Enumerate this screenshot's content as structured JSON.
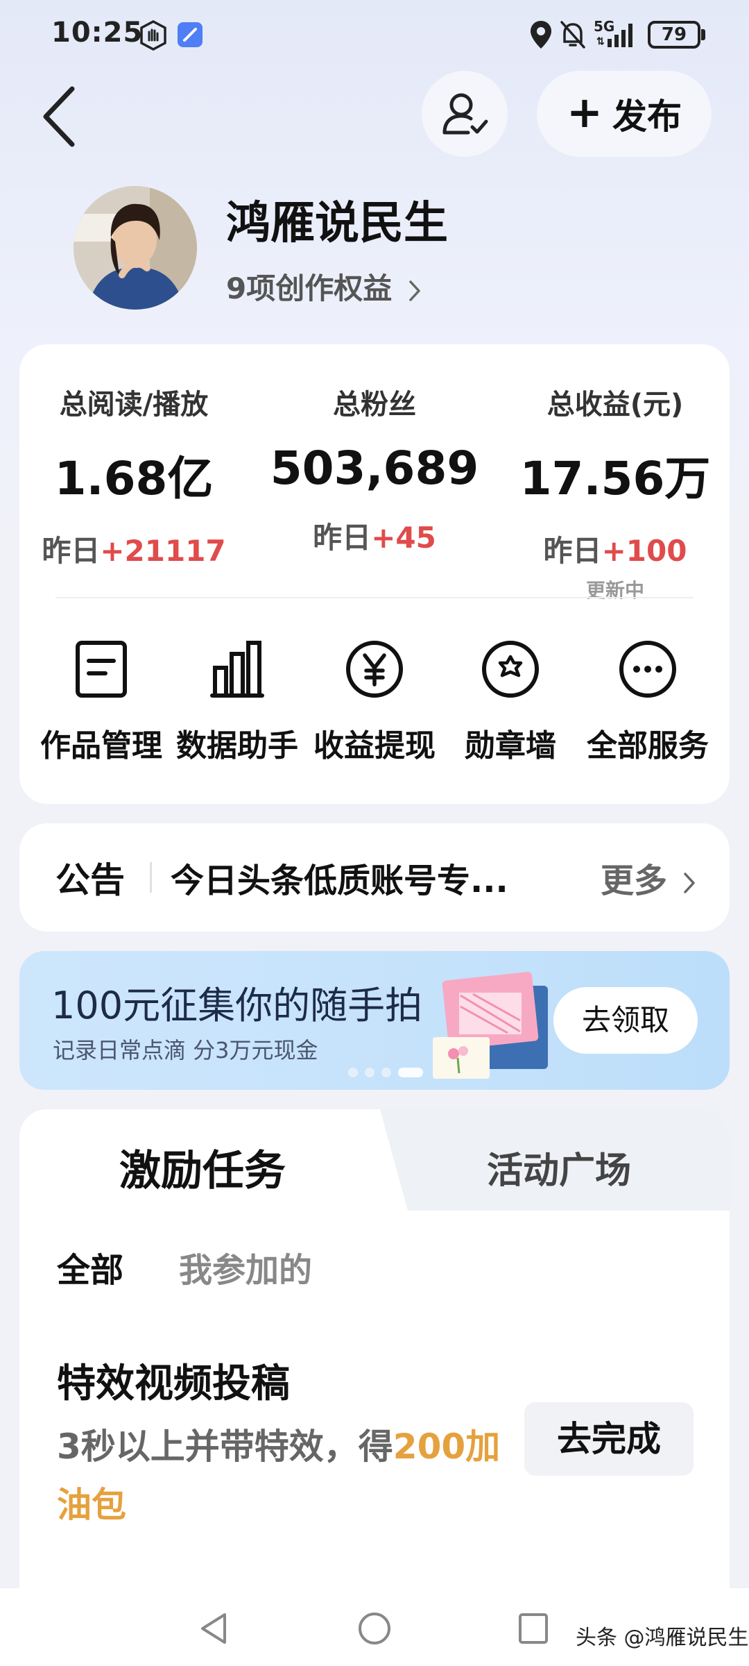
{
  "status_bar": {
    "time": "10:25",
    "network": "5G",
    "battery": "79"
  },
  "header": {
    "publish_label": "发布"
  },
  "profile": {
    "name": "鸿雁说民生",
    "rights_link": "9项创作权益"
  },
  "stats": [
    {
      "label": "总阅读/播放",
      "value": "1.68亿",
      "delta_prefix": "昨日",
      "delta": "+21117",
      "note": ""
    },
    {
      "label": "总粉丝",
      "value": "503,689",
      "delta_prefix": "昨日",
      "delta": "+45",
      "note": ""
    },
    {
      "label": "总收益(元)",
      "value": "17.56万",
      "delta_prefix": "昨日",
      "delta": "+100",
      "note": "更新中"
    }
  ],
  "services": [
    {
      "label": "作品管理",
      "icon": "document-icon"
    },
    {
      "label": "数据助手",
      "icon": "bar-chart-icon"
    },
    {
      "label": "收益提现",
      "icon": "yen-icon"
    },
    {
      "label": "勋章墙",
      "icon": "medal-icon"
    },
    {
      "label": "全部服务",
      "icon": "more-icon"
    }
  ],
  "notice": {
    "title": "公告",
    "text": "今日头条低质账号专...",
    "more": "更多"
  },
  "banner": {
    "title": "100元征集你的随手拍",
    "subtitle": "记录日常点滴 分3万元现金",
    "button": "去领取",
    "slides": 4,
    "active_slide": 4
  },
  "tasks": {
    "tabs": [
      "激励任务",
      "活动广场"
    ],
    "active_tab": "激励任务",
    "filters": [
      "全部",
      "我参加的"
    ],
    "active_filter": "全部",
    "item": {
      "title": "特效视频投稿",
      "desc_prefix": "3秒以上并带特效，得",
      "reward": "200加油包",
      "button": "去完成"
    }
  },
  "watermark": "头条 @鸿雁说民生",
  "colors": {
    "delta_up": "#e04b4b",
    "reward": "#e5a13e",
    "banner_bg": "#c5e2fb"
  }
}
